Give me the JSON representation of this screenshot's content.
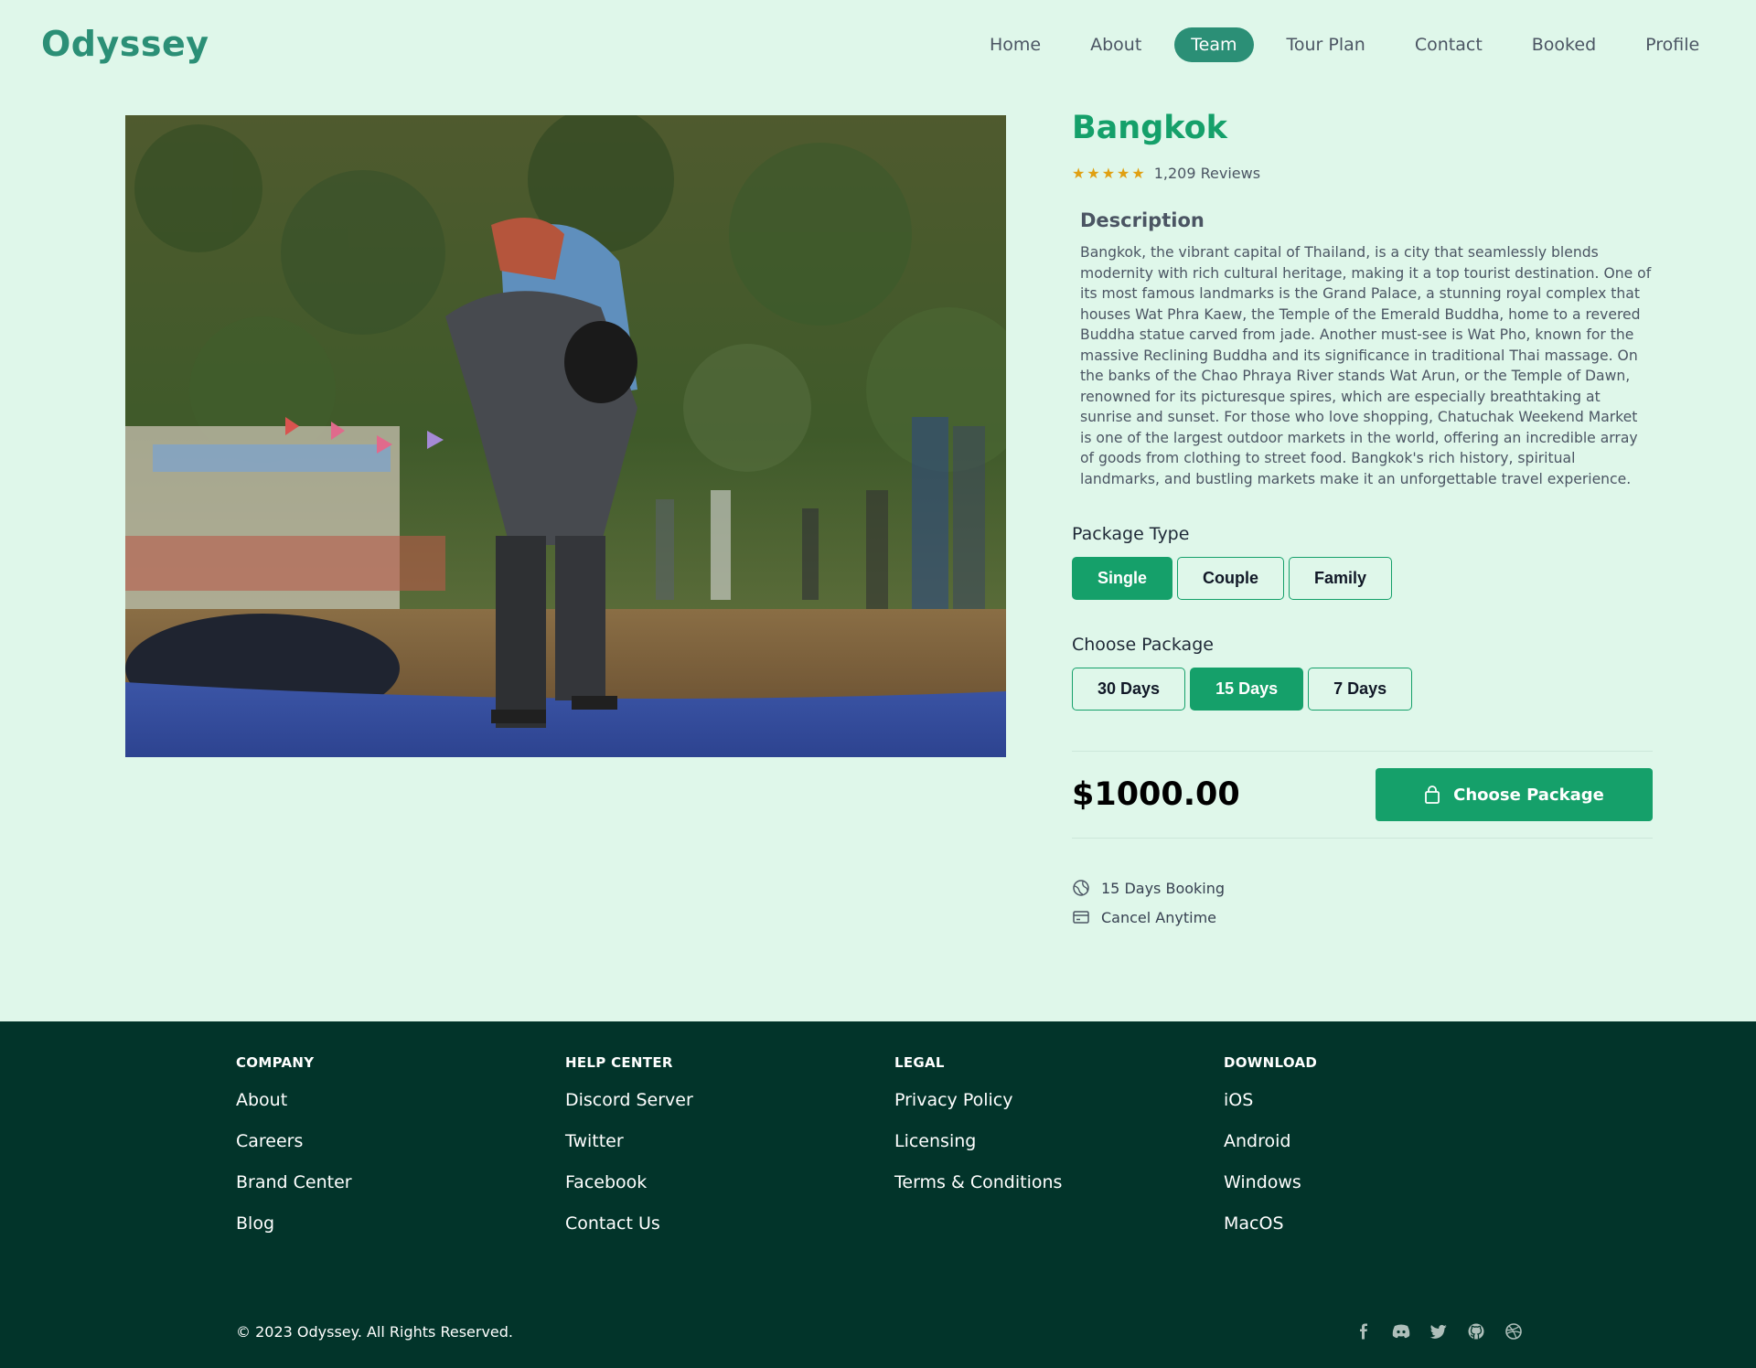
{
  "brand": {
    "logo": "Odyssey"
  },
  "nav": {
    "items": [
      {
        "label": "Home",
        "active": false
      },
      {
        "label": "About",
        "active": false
      },
      {
        "label": "Team",
        "active": true
      },
      {
        "label": "Tour Plan",
        "active": false
      },
      {
        "label": "Contact",
        "active": false
      },
      {
        "label": "Booked",
        "active": false
      },
      {
        "label": "Profile",
        "active": false
      }
    ]
  },
  "destination": {
    "name": "Bangkok",
    "rating": 5,
    "reviews": "1,209 Reviews",
    "description_title": "Description",
    "description": "Bangkok, the vibrant capital of Thailand, is a city that seamlessly blends modernity with rich cultural heritage, making it a top tourist destination. One of its most famous landmarks is the Grand Palace, a stunning royal complex that houses Wat Phra Kaew, the Temple of the Emerald Buddha, home to a revered Buddha statue carved from jade. Another must-see is Wat Pho, known for the massive Reclining Buddha and its significance in traditional Thai massage. On the banks of the Chao Phraya River stands Wat Arun, or the Temple of Dawn, renowned for its picturesque spires, which are especially breathtaking at sunrise and sunset. For those who love shopping, Chatuchak Weekend Market is one of the largest outdoor markets in the world, offering an incredible array of goods from clothing to street food. Bangkok's rich history, spiritual landmarks, and bustling markets make it an unforgettable travel experience."
  },
  "package_type": {
    "label": "Package Type",
    "options": [
      "Single",
      "Couple",
      "Family"
    ],
    "selected": "Single"
  },
  "package_duration": {
    "label": "Choose Package",
    "options": [
      "30 Days",
      "15 Days",
      "7 Days"
    ],
    "selected": "15 Days"
  },
  "price": {
    "amount": "$1000.00",
    "button_label": "Choose Package"
  },
  "features": [
    {
      "icon": "globe-icon",
      "text": "15 Days Booking"
    },
    {
      "icon": "credit-card-icon",
      "text": "Cancel Anytime"
    }
  ],
  "footer": {
    "columns": [
      {
        "title": "COMPANY",
        "links": [
          "About",
          "Careers",
          "Brand Center",
          "Blog"
        ]
      },
      {
        "title": "HELP CENTER",
        "links": [
          "Discord Server",
          "Twitter",
          "Facebook",
          "Contact Us"
        ]
      },
      {
        "title": "LEGAL",
        "links": [
          "Privacy Policy",
          "Licensing",
          "Terms & Conditions"
        ]
      },
      {
        "title": "DOWNLOAD",
        "links": [
          "iOS",
          "Android",
          "Windows",
          "MacOS"
        ]
      }
    ],
    "copyright": "© 2023 Odyssey. All Rights Reserved.",
    "socials": [
      "facebook-icon",
      "discord-icon",
      "twitter-icon",
      "github-icon",
      "dribbble-icon"
    ]
  },
  "colors": {
    "background": "#dff7ea",
    "brand": "#2b8f76",
    "accent": "#15a06a",
    "footer": "#02342a",
    "star": "#e0a012"
  }
}
